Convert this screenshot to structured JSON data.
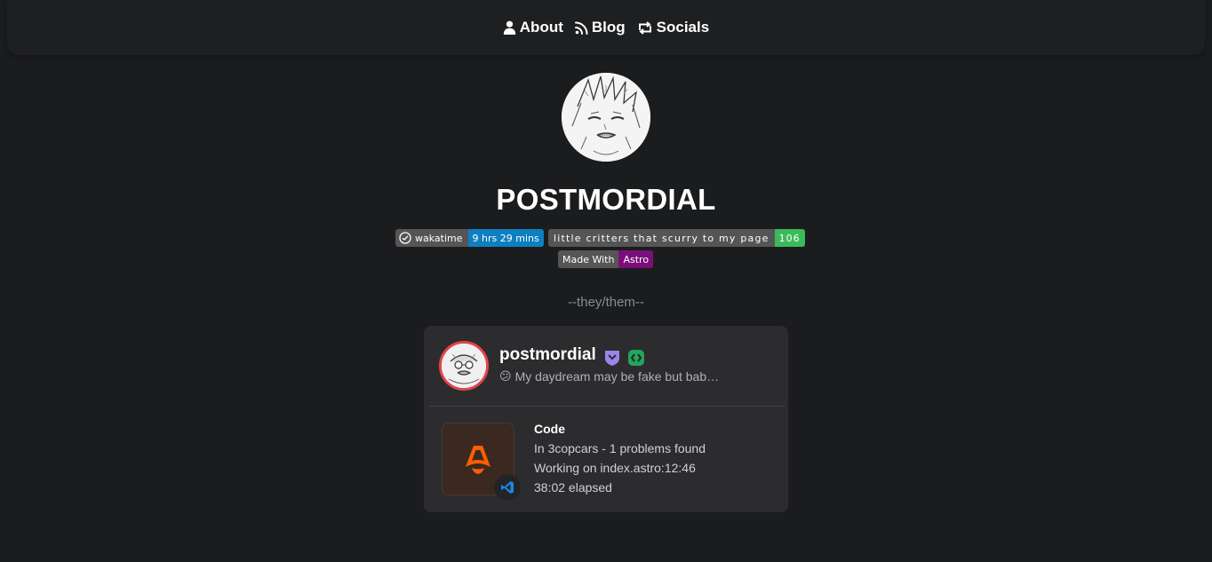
{
  "nav": {
    "items": [
      {
        "label": "About",
        "icon": "user-icon"
      },
      {
        "label": "Blog",
        "icon": "rss-icon"
      },
      {
        "label": "Socials",
        "icon": "repeat-icon"
      }
    ]
  },
  "profile": {
    "title": "POSTMORDIAL",
    "pronouns": "--they/them--"
  },
  "badges": {
    "wakatime": {
      "label": "wakatime",
      "value": "9 hrs 29 mins",
      "color": "#0e7fc0"
    },
    "visitors": {
      "label": "little critters that scurry to my page",
      "value": "106",
      "color": "#3cb95b"
    },
    "made_with": {
      "label": "Made With",
      "value": "Astro",
      "color": "#7a0f7a"
    }
  },
  "presence": {
    "username": "postmordial",
    "status_emoji": "😕",
    "status_text": "My daydream may be fake but bab…",
    "activity": {
      "name": "Code",
      "details": "In 3copcars - 1 problems found",
      "state": "Working on index.astro:12:46",
      "elapsed": "38:02 elapsed"
    },
    "colors": {
      "avatar_ring": "#e0454b",
      "hypesquad": "#9b84ec",
      "active_developer": "#23a55a",
      "astro_orange": "#ff5d01",
      "vscode_blue": "#1e88e5"
    }
  }
}
